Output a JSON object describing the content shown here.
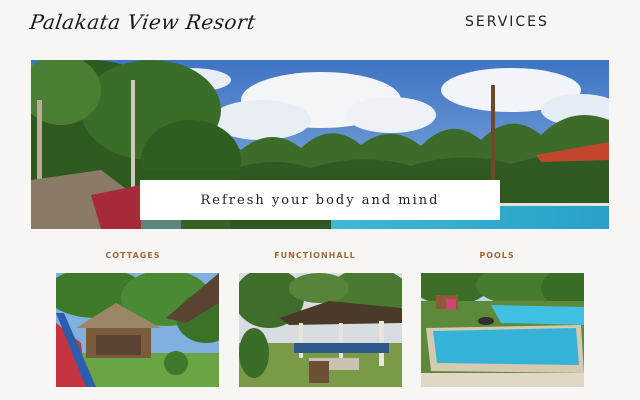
{
  "header": {
    "logo_text": "Palakata View Resort",
    "nav_services": "SERVICES"
  },
  "hero": {
    "tagline": "Refresh your body and mind"
  },
  "categories": [
    {
      "label": "COTTAGES"
    },
    {
      "label": "FUNCTIONHALL"
    },
    {
      "label": "POOLS"
    }
  ],
  "colors": {
    "background": "#f7f6f4",
    "category_label": "#a06a3a",
    "sky": "#4f83c9",
    "foliage": "#3f6f2c",
    "pool": "#38b6d6"
  }
}
